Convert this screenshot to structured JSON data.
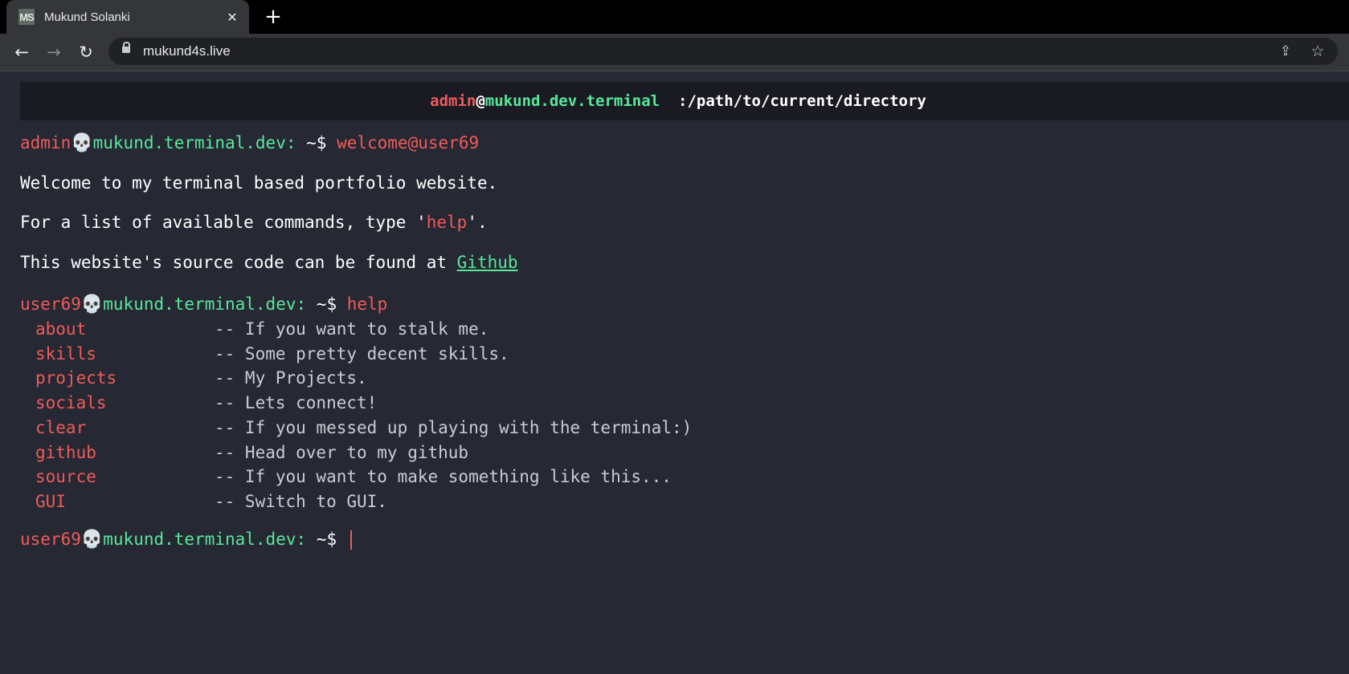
{
  "browser": {
    "tab": {
      "favicon_text": "MS",
      "title": "Mukund Solanki",
      "close_icon": "close-icon"
    },
    "new_tab_icon": "plus-icon",
    "nav": {
      "back_icon": "arrow-left-icon",
      "forward_icon": "arrow-right-icon",
      "reload_icon": "reload-icon"
    },
    "url": "mukund4s.live",
    "lock_icon": "lock-icon",
    "share_icon": "share-icon",
    "bookmark_icon": "star-icon"
  },
  "header": {
    "user": "admin",
    "at": "@",
    "host": "mukund.dev.terminal",
    "path": ":/path/to/current/directory"
  },
  "terminal": {
    "welcome_prompt": {
      "user": "admin",
      "skull": "💀",
      "host": "mukund.terminal.dev:",
      "tilde": "~$",
      "command": "welcome@user69"
    },
    "welcome_line1": "Welcome to my terminal based portfolio website.",
    "welcome_line2_pre": "For a list of available commands, type '",
    "welcome_line2_cmd": "help",
    "welcome_line2_post": "'.",
    "welcome_line3_pre": "This website's source code can be found at ",
    "welcome_line3_link": "Github",
    "help_prompt": {
      "user": "user69",
      "skull": "💀",
      "host": "mukund.terminal.dev:",
      "tilde": "~$",
      "command": "help"
    },
    "commands": [
      {
        "name": "about",
        "desc": "-- If you want to stalk me."
      },
      {
        "name": "skills",
        "desc": "-- Some pretty decent skills."
      },
      {
        "name": "projects",
        "desc": "-- My Projects."
      },
      {
        "name": "socials",
        "desc": "-- Lets connect!"
      },
      {
        "name": "clear",
        "desc": "-- If you messed up playing with the terminal:)"
      },
      {
        "name": "github",
        "desc": "-- Head over to my github"
      },
      {
        "name": "source",
        "desc": "-- If you want to make something like this..."
      },
      {
        "name": "GUI",
        "desc": "-- Switch to GUI."
      }
    ],
    "input_prompt": {
      "user": "user69",
      "skull": "💀",
      "host": "mukund.terminal.dev:",
      "tilde": "~$"
    },
    "input_value": ""
  },
  "colors": {
    "background": "#262833",
    "header_bg": "#1a1b22",
    "accent_red": "#ef5b5b",
    "accent_green": "#58e89a"
  }
}
